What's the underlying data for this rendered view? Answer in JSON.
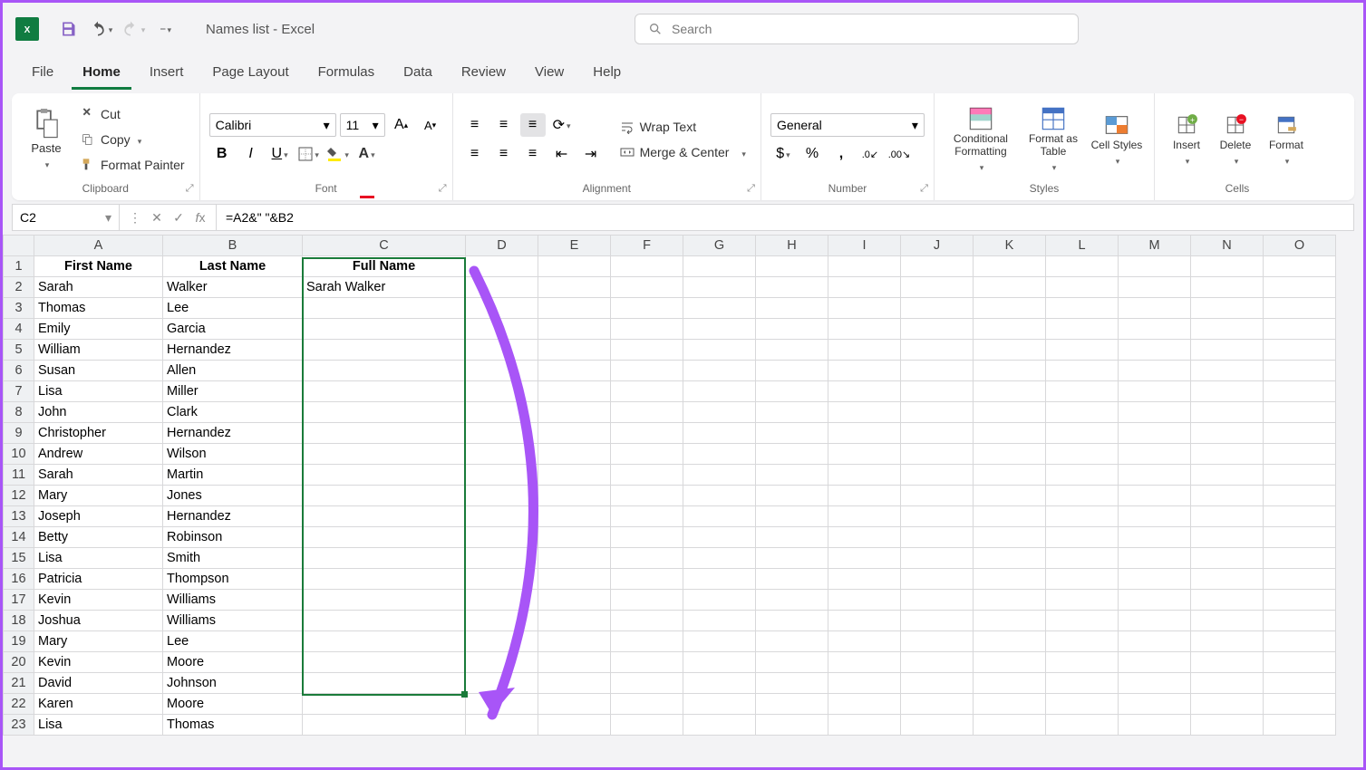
{
  "title": "Names list - Excel",
  "search_placeholder": "Search",
  "tabs": {
    "file": "File",
    "home": "Home",
    "insert": "Insert",
    "page_layout": "Page Layout",
    "formulas": "Formulas",
    "data": "Data",
    "review": "Review",
    "view": "View",
    "help": "Help"
  },
  "ribbon": {
    "clipboard": {
      "label": "Clipboard",
      "paste": "Paste",
      "cut": "Cut",
      "copy": "Copy",
      "painter": "Format Painter"
    },
    "font": {
      "label": "Font",
      "name": "Calibri",
      "size": "11"
    },
    "alignment": {
      "label": "Alignment",
      "wrap": "Wrap Text",
      "merge": "Merge & Center"
    },
    "number": {
      "label": "Number",
      "format": "General"
    },
    "styles": {
      "label": "Styles",
      "cond": "Conditional Formatting",
      "table": "Format as Table",
      "cell": "Cell Styles"
    },
    "cells": {
      "label": "Cells",
      "insert": "Insert",
      "delete": "Delete",
      "format": "Format"
    }
  },
  "formula_bar": {
    "ref": "C2",
    "formula": "=A2&\" \"&B2"
  },
  "columns": [
    "A",
    "B",
    "C",
    "D",
    "E",
    "F",
    "G",
    "H",
    "I",
    "J",
    "K",
    "L",
    "M",
    "N",
    "O"
  ],
  "headers": {
    "a": "First Name",
    "b": "Last Name",
    "c": "Full Name"
  },
  "rows": [
    {
      "n": 1
    },
    {
      "n": 2,
      "a": "Sarah",
      "b": "Walker",
      "c": "Sarah Walker"
    },
    {
      "n": 3,
      "a": "Thomas",
      "b": "Lee",
      "c": ""
    },
    {
      "n": 4,
      "a": "Emily",
      "b": "Garcia",
      "c": ""
    },
    {
      "n": 5,
      "a": "William",
      "b": "Hernandez",
      "c": ""
    },
    {
      "n": 6,
      "a": "Susan",
      "b": "Allen",
      "c": ""
    },
    {
      "n": 7,
      "a": "Lisa",
      "b": "Miller",
      "c": ""
    },
    {
      "n": 8,
      "a": "John",
      "b": "Clark",
      "c": ""
    },
    {
      "n": 9,
      "a": "Christopher",
      "b": "Hernandez",
      "c": ""
    },
    {
      "n": 10,
      "a": "Andrew",
      "b": "Wilson",
      "c": ""
    },
    {
      "n": 11,
      "a": "Sarah",
      "b": "Martin",
      "c": ""
    },
    {
      "n": 12,
      "a": "Mary",
      "b": "Jones",
      "c": ""
    },
    {
      "n": 13,
      "a": "Joseph",
      "b": "Hernandez",
      "c": ""
    },
    {
      "n": 14,
      "a": "Betty",
      "b": "Robinson",
      "c": ""
    },
    {
      "n": 15,
      "a": "Lisa",
      "b": "Smith",
      "c": ""
    },
    {
      "n": 16,
      "a": "Patricia",
      "b": "Thompson",
      "c": ""
    },
    {
      "n": 17,
      "a": "Kevin",
      "b": "Williams",
      "c": ""
    },
    {
      "n": 18,
      "a": "Joshua",
      "b": "Williams",
      "c": ""
    },
    {
      "n": 19,
      "a": "Mary",
      "b": "Lee",
      "c": ""
    },
    {
      "n": 20,
      "a": "Kevin",
      "b": "Moore",
      "c": ""
    },
    {
      "n": 21,
      "a": "David",
      "b": "Johnson",
      "c": ""
    },
    {
      "n": 22,
      "a": "Karen",
      "b": "Moore",
      "c": ""
    },
    {
      "n": 23,
      "a": "Lisa",
      "b": "Thomas",
      "c": ""
    }
  ]
}
